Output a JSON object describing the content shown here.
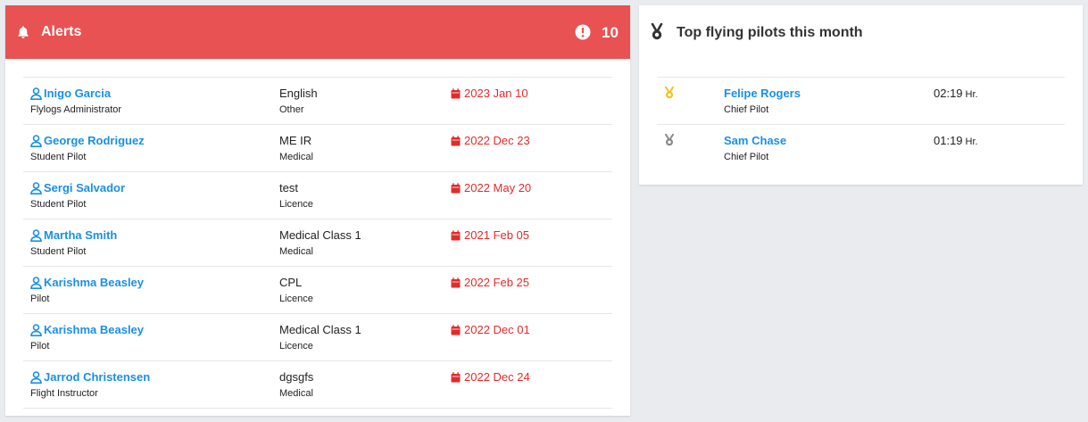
{
  "alerts": {
    "title": "Alerts",
    "count": "10",
    "rows": [
      {
        "name": "Inigo Garcia",
        "role": "Flylogs Administrator",
        "item": "English",
        "type": "Other",
        "date": "2023 Jan 10"
      },
      {
        "name": "George Rodriguez",
        "role": "Student Pilot",
        "item": "ME IR",
        "type": "Medical",
        "date": "2022 Dec 23"
      },
      {
        "name": "Sergi Salvador",
        "role": "Student Pilot",
        "item": "test",
        "type": "Licence",
        "date": "2022 May 20"
      },
      {
        "name": "Martha Smith",
        "role": "Student Pilot",
        "item": "Medical Class 1",
        "type": "Medical",
        "date": "2021 Feb 05"
      },
      {
        "name": "Karishma Beasley",
        "role": "Pilot",
        "item": "CPL",
        "type": "Licence",
        "date": "2022 Feb 25"
      },
      {
        "name": "Karishma Beasley",
        "role": "Pilot",
        "item": "Medical Class 1",
        "type": "Licence",
        "date": "2022 Dec 01"
      },
      {
        "name": "Jarrod Christensen",
        "role": "Flight Instructor",
        "item": "dgsgfs",
        "type": "Medical",
        "date": "2022 Dec 24"
      }
    ]
  },
  "top_pilots": {
    "title": "Top flying pilots this month",
    "unit": "Hr.",
    "rows": [
      {
        "medal": "gold-medal-icon",
        "medal_color": "#f0c419",
        "name": "Felipe Rogers",
        "role": "Chief Pilot",
        "time": "02:19"
      },
      {
        "medal": "silver-medal-icon",
        "medal_color": "#8a8a8a",
        "name": "Sam Chase",
        "role": "Chief Pilot",
        "time": "01:19"
      }
    ]
  },
  "colors": {
    "alert_header": "#e85252",
    "link": "#1a8fe6",
    "date": "#e22b2b"
  }
}
